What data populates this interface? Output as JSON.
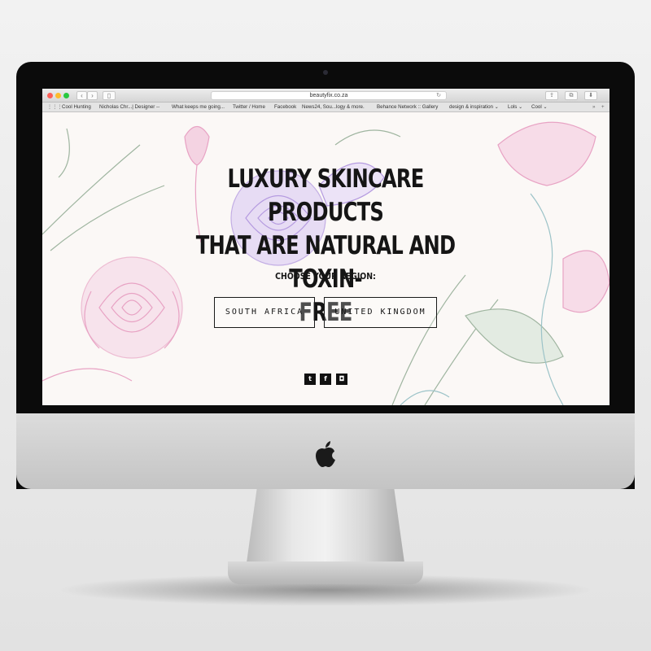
{
  "browser": {
    "url": "beautyfix.co.za",
    "bookmarks": [
      "Cool Hunting",
      "Nicholas Chr...| Designer --",
      "What keeps me going...",
      "Twitter / Home",
      "Facebook",
      "News24, Sou...logy & more.",
      "Behance Network :: Gallery",
      "design & inspiration ⌄",
      "Lols ⌄",
      "Cool ⌄"
    ],
    "bookmarks_overflow": "»",
    "add_bookmark": "+"
  },
  "hero": {
    "headline_line1": "LUXURY SKINCARE PRODUCTS",
    "headline_line2": "THAT ARE NATURAL AND TOXIN-",
    "headline_line3": "FREE",
    "region_prompt": "CHOOSE YOUR REGION:",
    "buttons": {
      "south_africa": "SOUTH AFRICA",
      "united_kingdom": "UNITED KINGDOM"
    }
  },
  "social": {
    "twitter": "t",
    "facebook": "f",
    "instagram": "◘"
  },
  "icons": [
    "twitter-icon",
    "facebook-icon",
    "instagram-icon",
    "apple-logo-icon",
    "back-icon",
    "forward-icon",
    "sidebar-icon",
    "reload-icon",
    "share-icon",
    "tabs-icon",
    "download-icon"
  ],
  "colors": {
    "page_background": "#fbf8f6",
    "text": "#151515",
    "rose_pink": "#e8a3c4",
    "lavender": "#b59be0",
    "sage_green": "#9fb5a0",
    "monitor_bezel": "#0b0b0b"
  }
}
